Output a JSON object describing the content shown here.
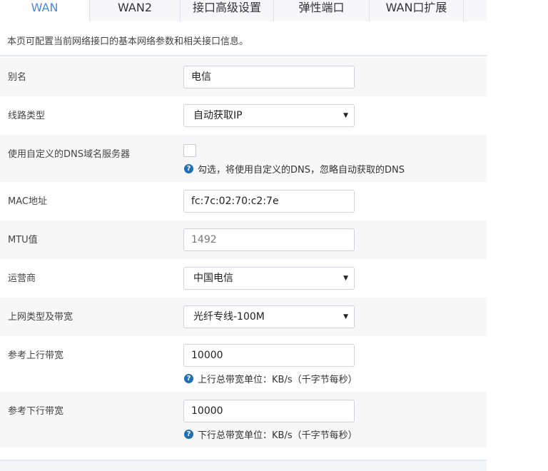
{
  "tabs": [
    "WAN",
    "WAN2",
    "接口高级设置",
    "弹性端口",
    "WAN口扩展"
  ],
  "description": "本页可配置当前网络接口的基本网络参数和相关接口信息。",
  "form": {
    "alias": {
      "label": "别名",
      "value": "电信"
    },
    "line_type": {
      "label": "线路类型",
      "value": "自动获取IP"
    },
    "custom_dns": {
      "label": "使用自定义的DNS域名服务器",
      "hint": "勾选，将使用自定义的DNS，忽略自动获取的DNS",
      "checked": false
    },
    "mac": {
      "label": "MAC地址",
      "value": "fc:7c:02:70:c2:7e"
    },
    "mtu": {
      "label": "MTU值",
      "placeholder": "1492"
    },
    "isp": {
      "label": "运营商",
      "value": "中国电信"
    },
    "access_type": {
      "label": "上网类型及带宽",
      "value": "光纤专线-100M"
    },
    "upstream": {
      "label": "参考上行带宽",
      "value": "10000",
      "hint": "上行总带宽单位：KB/s（千字节每秒）"
    },
    "downstream": {
      "label": "参考下行带宽",
      "value": "10000",
      "hint": "下行总带宽单位：KB/s（千字节每秒）"
    }
  },
  "icons": {
    "help": "question-circle-icon",
    "dropdown": "caret-down-icon"
  },
  "colors": {
    "active_tab": "#4a89dc",
    "help_icon": "#1f6fb5"
  }
}
